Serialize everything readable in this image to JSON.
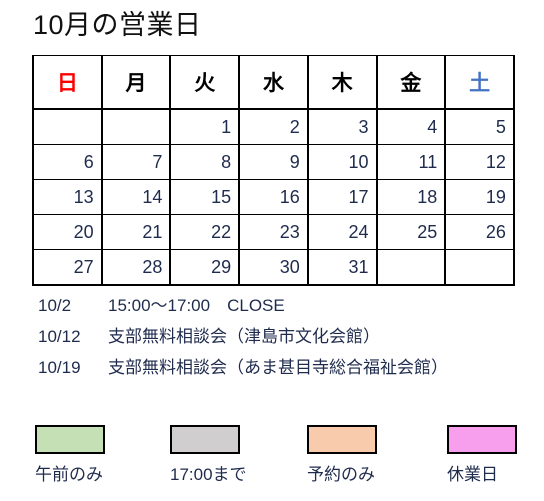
{
  "page": {
    "title": "10月の営業日"
  },
  "calendar": {
    "weekday_headers": [
      {
        "label": "日",
        "kind": "sun"
      },
      {
        "label": "月",
        "kind": "weekday"
      },
      {
        "label": "火",
        "kind": "weekday"
      },
      {
        "label": "水",
        "kind": "weekday"
      },
      {
        "label": "木",
        "kind": "weekday"
      },
      {
        "label": "金",
        "kind": "weekday"
      },
      {
        "label": "土",
        "kind": "sat"
      }
    ],
    "weeks": [
      [
        {
          "day": "",
          "type": "none"
        },
        {
          "day": "",
          "type": "none"
        },
        {
          "day": "1",
          "type": "open"
        },
        {
          "day": "2",
          "type": "open"
        },
        {
          "day": "3",
          "type": "until17"
        },
        {
          "day": "4",
          "type": "am"
        },
        {
          "day": "5",
          "type": "appt"
        }
      ],
      [
        {
          "day": "6",
          "type": "am"
        },
        {
          "day": "7",
          "type": "open"
        },
        {
          "day": "8",
          "type": "open"
        },
        {
          "day": "9",
          "type": "open"
        },
        {
          "day": "10",
          "type": "open"
        },
        {
          "day": "11",
          "type": "am"
        },
        {
          "day": "12",
          "type": "closed"
        }
      ],
      [
        {
          "day": "13",
          "type": "am"
        },
        {
          "day": "14",
          "type": "am"
        },
        {
          "day": "15",
          "type": "open"
        },
        {
          "day": "16",
          "type": "open"
        },
        {
          "day": "17",
          "type": "until17"
        },
        {
          "day": "18",
          "type": "closed"
        },
        {
          "day": "19",
          "type": "closed"
        }
      ],
      [
        {
          "day": "20",
          "type": "am"
        },
        {
          "day": "21",
          "type": "open"
        },
        {
          "day": "22",
          "type": "open"
        },
        {
          "day": "23",
          "type": "open"
        },
        {
          "day": "24",
          "type": "open"
        },
        {
          "day": "25",
          "type": "am"
        },
        {
          "day": "26",
          "type": "appt"
        }
      ],
      [
        {
          "day": "27",
          "type": "am"
        },
        {
          "day": "28",
          "type": "open"
        },
        {
          "day": "29",
          "type": "open"
        },
        {
          "day": "30",
          "type": "open"
        },
        {
          "day": "31",
          "type": "until17"
        },
        {
          "day": "",
          "type": "none"
        },
        {
          "day": "",
          "type": "none"
        }
      ]
    ]
  },
  "notes": [
    {
      "date": "10/2",
      "text": "15:00〜17:00　CLOSE"
    },
    {
      "date": "10/12",
      "text": "支部無料相談会（津島市文化会館）"
    },
    {
      "date": "10/19",
      "text": "支部無料相談会（あま甚目寺総合福祉会館）"
    }
  ],
  "legend": [
    {
      "label": "午前のみ",
      "color": "#C5E0B4",
      "type": "am"
    },
    {
      "label": "17:00まで",
      "color": "#D0CECE",
      "type": "until17"
    },
    {
      "label": "予約のみ",
      "color": "#F8CBAD",
      "type": "appt"
    },
    {
      "label": "休業日",
      "color": "#F79FEC",
      "type": "closed"
    }
  ],
  "colors": {
    "open": "#BDD7EE",
    "morning_only": "#C5E0B4",
    "until_17": "#D0CECE",
    "by_appointment": "#F8CBAD",
    "closed": "#F79FEC",
    "sunday_text": "#FF0000",
    "saturday_text": "#4472C4",
    "grid_line": "#000000"
  }
}
